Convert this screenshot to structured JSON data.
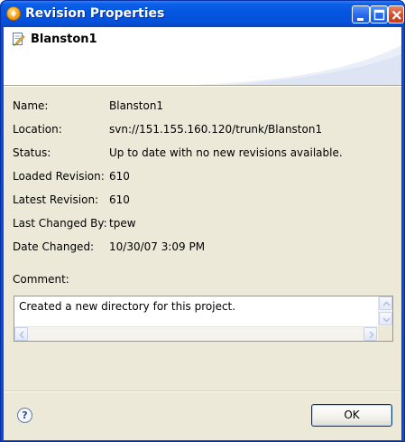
{
  "window": {
    "title": "Revision Properties"
  },
  "header": {
    "item_name": "Blanston1"
  },
  "properties": [
    {
      "label": "Name:",
      "value": "Blanston1"
    },
    {
      "label": "Location:",
      "value": "svn://151.155.160.120/trunk/Blanston1"
    },
    {
      "label": "Status:",
      "value": "Up to date with no new revisions available."
    },
    {
      "label": "Loaded Revision:",
      "value": "610"
    },
    {
      "label": "Latest Revision:",
      "value": "610"
    },
    {
      "label": "Last Changed By:",
      "value": "tpew"
    },
    {
      "label": "Date Changed:",
      "value": "10/30/07 3:09 PM"
    }
  ],
  "comment": {
    "label": "Comment:",
    "text": "Created a new directory for this project."
  },
  "footer": {
    "help_icon": "help-icon",
    "ok_label": "OK"
  },
  "colors": {
    "titlebar": "#0355e0",
    "dialog_bg": "#ece9d8",
    "header_bg": "#ffffff"
  }
}
